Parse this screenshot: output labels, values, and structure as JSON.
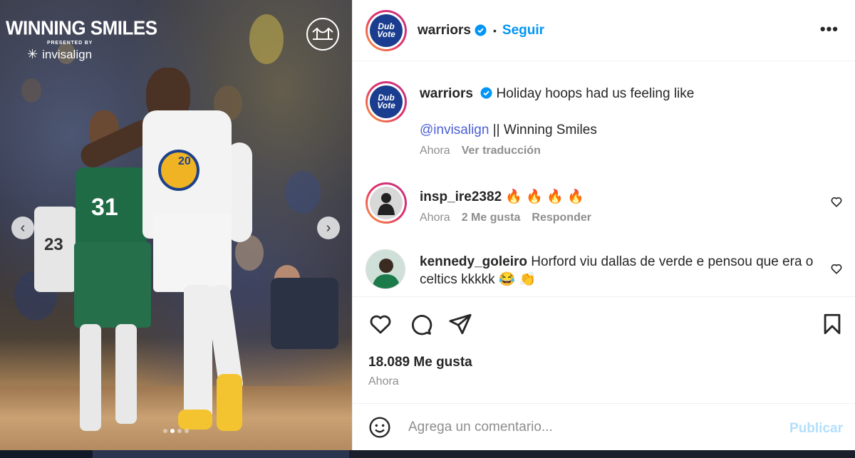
{
  "media": {
    "brand_title": "WINNING SMILES",
    "brand_presented": "PRESENTED BY",
    "brand_sponsor": "invisalign",
    "green_jersey_number": "31",
    "gray_jersey_number": "23",
    "white_jersey_number": "20",
    "carousel_count": 4,
    "carousel_active_index": 1
  },
  "header": {
    "avatar_text_line1": "Dub",
    "avatar_text_line2": "Vote",
    "username": "warriors",
    "bullet": "•",
    "follow_label": "Seguir",
    "more_label": "•••"
  },
  "caption": {
    "username": "warriors",
    "text_line1": "Holiday hoops had us feeling like",
    "mention": "@invisalign",
    "text_line2": " || Winning Smiles",
    "time": "Ahora",
    "translate_label": "Ver traducción"
  },
  "comments": [
    {
      "username": "insp_ire2382",
      "text": "🔥 🔥 🔥 🔥",
      "time": "Ahora",
      "likes_label": "2 Me gusta",
      "reply_label": "Responder"
    },
    {
      "username": "kennedy_goleiro",
      "text": "Horford viu dallas de verde e pensou que era o celtics kkkkk 😂 👏"
    }
  ],
  "footer": {
    "likes": "18.089 Me gusta",
    "time": "Ahora",
    "comment_placeholder": "Agrega un comentario...",
    "publish_label": "Publicar"
  },
  "colors": {
    "accent": "#0095f6",
    "mention": "#4c5fd5",
    "muted": "#8e8e8e",
    "publish_disabled": "#b2dffc"
  }
}
